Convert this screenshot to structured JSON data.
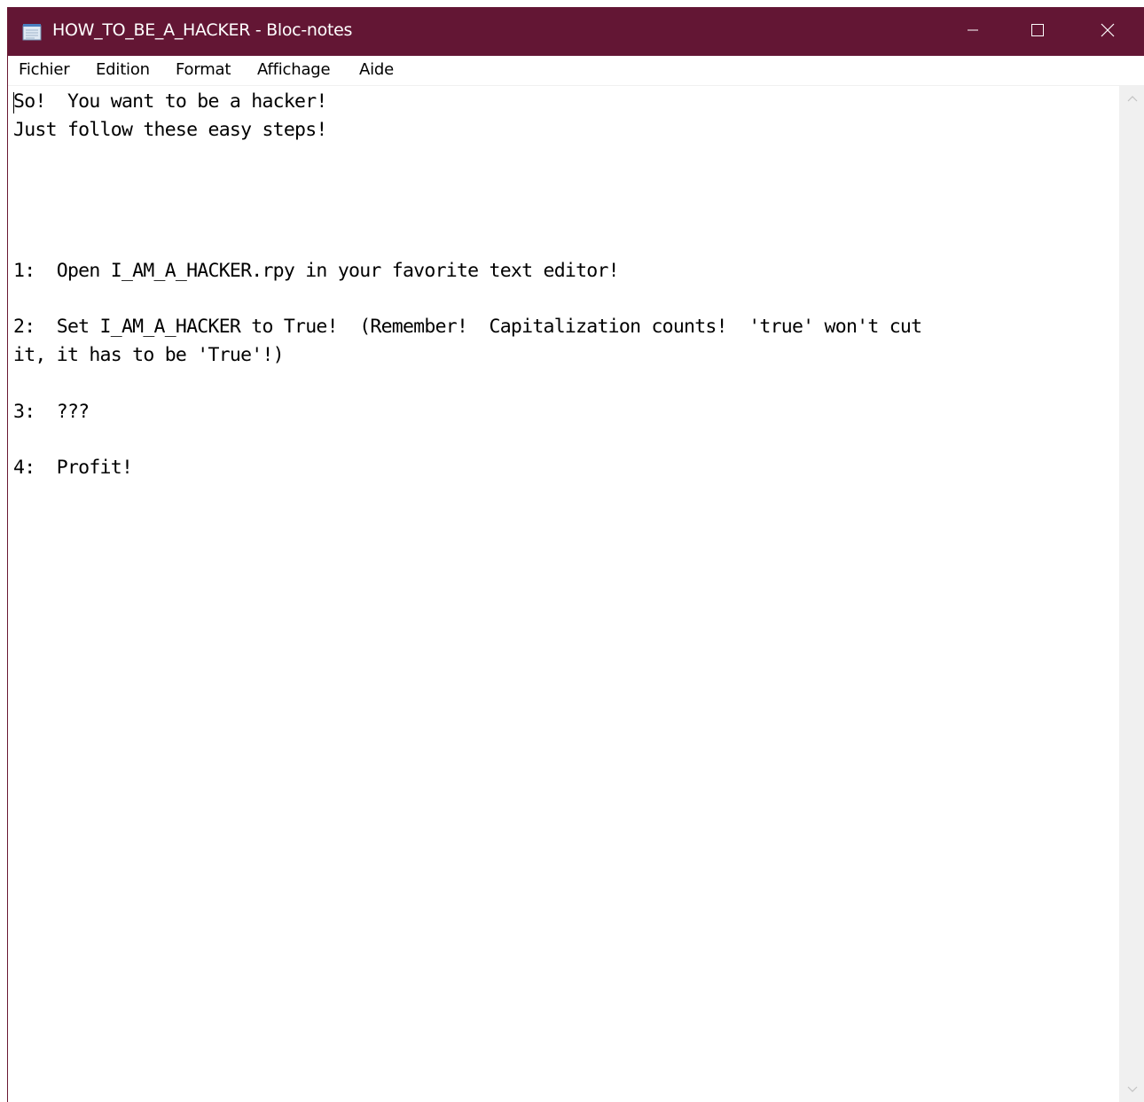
{
  "window": {
    "title": "HOW_TO_BE_A_HACKER - Bloc-notes",
    "accent_color": "#631634"
  },
  "titlebar": {
    "app_icon": "notepad-icon",
    "controls": {
      "minimize_icon": "minimize-icon",
      "maximize_icon": "maximize-icon",
      "close_icon": "close-icon"
    }
  },
  "menubar": {
    "items": [
      {
        "label": "Fichier"
      },
      {
        "label": "Edition"
      },
      {
        "label": "Format"
      },
      {
        "label": "Affichage"
      },
      {
        "label": "Aide"
      }
    ]
  },
  "editor": {
    "content": "So!  You want to be a hacker!\nJust follow these easy steps!\n\n\n\n\n1:  Open I_AM_A_HACKER.rpy in your favorite text editor!\n\n2:  Set I_AM_A_HACKER to True!  (Remember!  Capitalization counts!  'true' won't cut\nit, it has to be 'True'!)\n\n3:  ???\n\n4:  Profit!"
  },
  "scrollbar": {
    "up_icon": "chevron-up-icon",
    "down_icon": "chevron-down-icon"
  }
}
